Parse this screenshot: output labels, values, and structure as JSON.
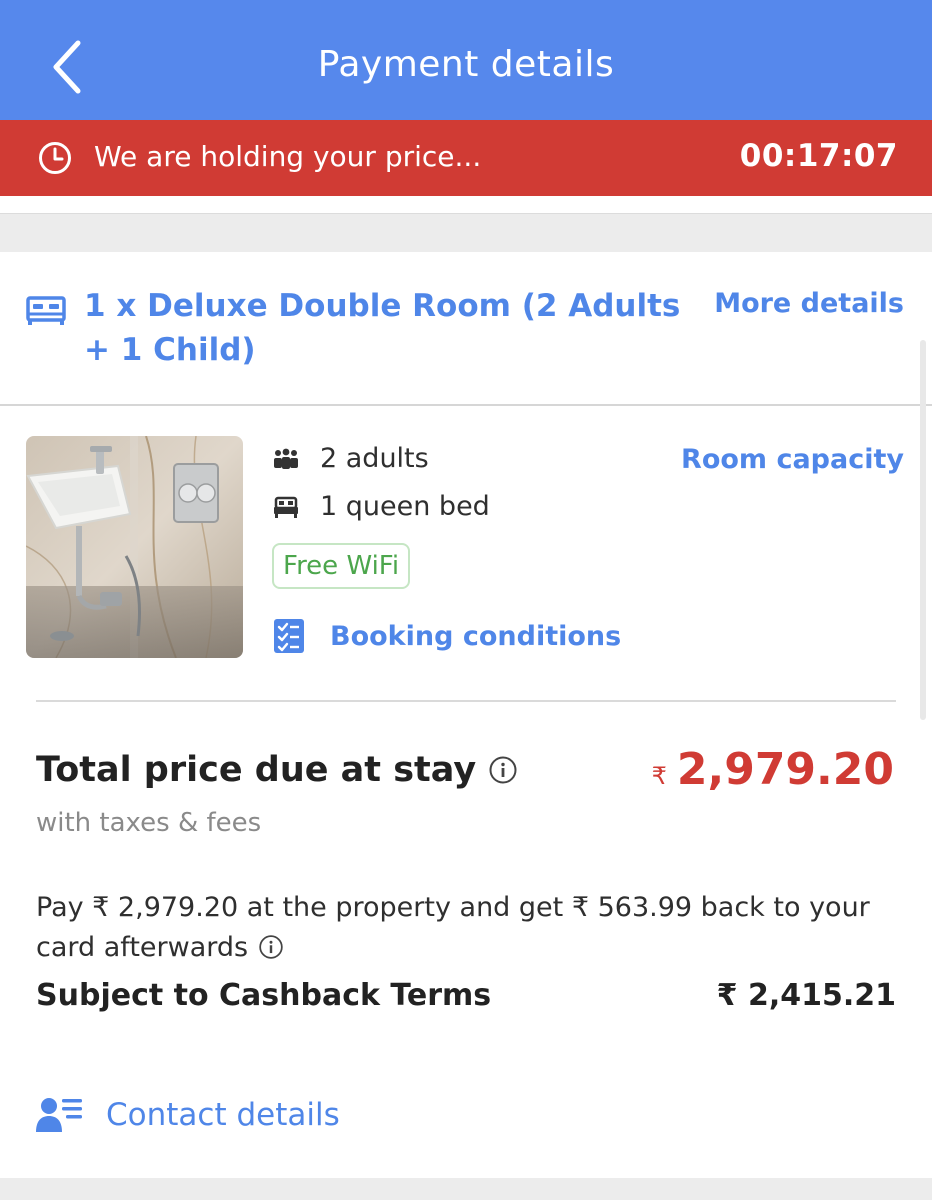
{
  "header": {
    "title": "Payment details"
  },
  "hold_banner": {
    "message": "We are holding your price...",
    "timer": "00:17:07"
  },
  "room": {
    "title": "1 x Deluxe Double Room (2 Adults + 1 Child)",
    "more_details_label": "More details",
    "capacity": "2 adults",
    "bed": "1 queen bed",
    "room_capacity_label": "Room capacity",
    "amenity_badge": "Free WiFi",
    "booking_conditions_label": "Booking conditions"
  },
  "price": {
    "total_label": "Total price due at stay",
    "currency_symbol": "₹",
    "total_amount": "2,979.20",
    "taxes_note": "with taxes & fees",
    "pay_note": "Pay ₹ 2,979.20 at the property and get ₹ 563.99 back to your card afterwards",
    "cashback_label": "Subject to Cashback Terms",
    "cashback_value": "₹ 2,415.21"
  },
  "contact": {
    "label": "Contact details"
  },
  "colors": {
    "header_bg": "#5688ec",
    "banner_bg": "#d03b34",
    "link": "#4f86e8",
    "price": "#d03b34",
    "badge_text": "#4ca64c"
  },
  "icons": [
    "chevron-left-icon",
    "clock-icon",
    "bed-icon",
    "people-icon",
    "queen-bed-icon",
    "checklist-icon",
    "info-icon",
    "contact-card-icon"
  ]
}
